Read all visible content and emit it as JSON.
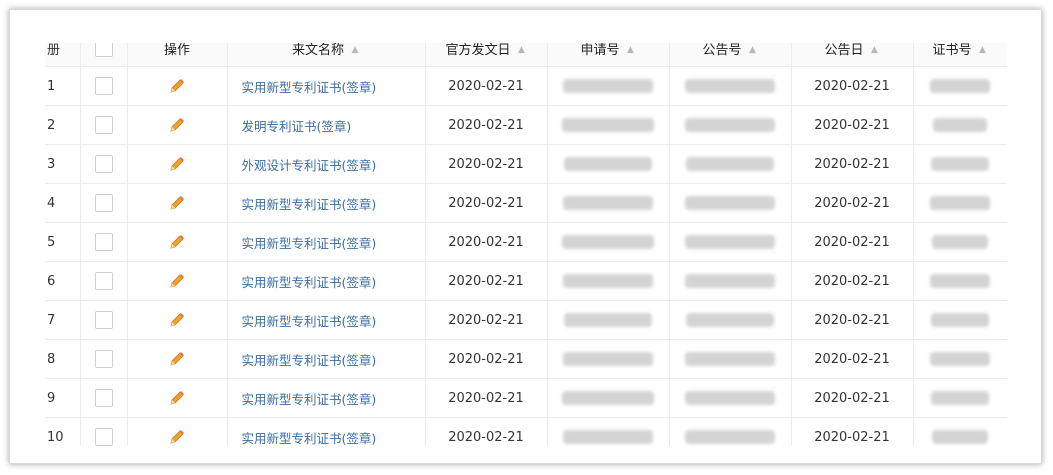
{
  "table": {
    "headers": {
      "index": "册",
      "action": "操作",
      "name": "来文名称",
      "date": "官方发文日",
      "app_no": "申请号",
      "pub_no": "公告号",
      "pub_date": "公告日",
      "cert_no": "证书号"
    },
    "rows": [
      {
        "index": "1",
        "name": "实用新型专利证书(签章)",
        "date": "2020-02-21",
        "pub_date": "2020-02-21"
      },
      {
        "index": "2",
        "name": "发明专利证书(签章)",
        "date": "2020-02-21",
        "pub_date": "2020-02-21"
      },
      {
        "index": "3",
        "name": "外观设计专利证书(签章)",
        "date": "2020-02-21",
        "pub_date": "2020-02-21"
      },
      {
        "index": "4",
        "name": "实用新型专利证书(签章)",
        "date": "2020-02-21",
        "pub_date": "2020-02-21"
      },
      {
        "index": "5",
        "name": "实用新型专利证书(签章)",
        "date": "2020-02-21",
        "pub_date": "2020-02-21"
      },
      {
        "index": "6",
        "name": "实用新型专利证书(签章)",
        "date": "2020-02-21",
        "pub_date": "2020-02-21"
      },
      {
        "index": "7",
        "name": "实用新型专利证书(签章)",
        "date": "2020-02-21",
        "pub_date": "2020-02-21"
      },
      {
        "index": "8",
        "name": "实用新型专利证书(签章)",
        "date": "2020-02-21",
        "pub_date": "2020-02-21"
      },
      {
        "index": "9",
        "name": "实用新型专利证书(签章)",
        "date": "2020-02-21",
        "pub_date": "2020-02-21"
      },
      {
        "index": "10",
        "name": "实用新型专利证书(签章)",
        "date": "2020-02-21",
        "pub_date": "2020-02-21"
      }
    ]
  },
  "icons": {
    "edit": "pencil-icon",
    "sort": "sort-icon",
    "checkbox": "checkbox"
  },
  "colors": {
    "link": "#3a6ea5",
    "pencil": "#f0a030",
    "border": "#ebebeb"
  }
}
